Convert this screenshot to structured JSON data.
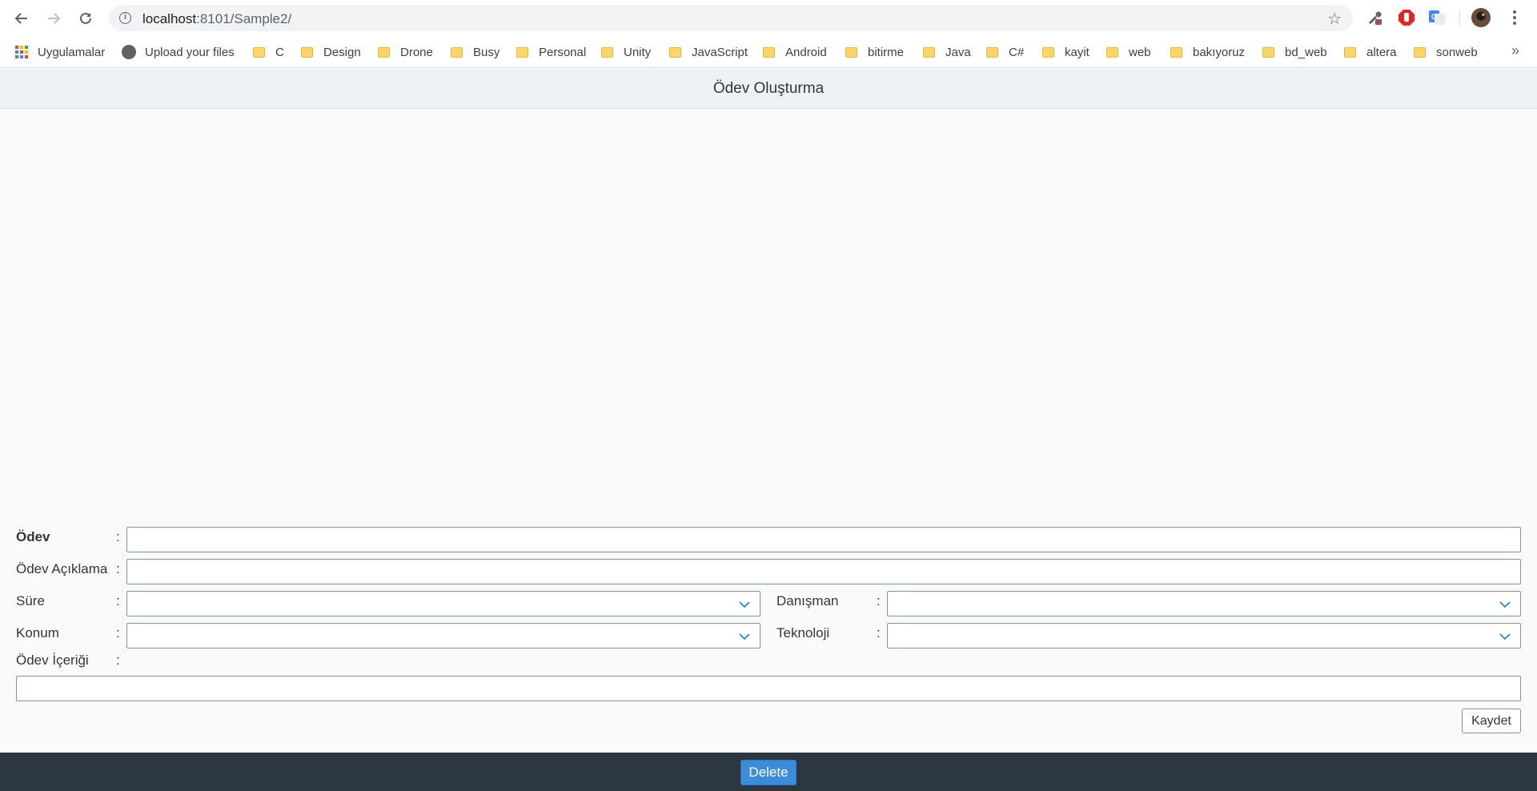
{
  "browser": {
    "url_host": "localhost",
    "url_path": ":8101/Sample2/",
    "bookmarks": {
      "apps": "Uygulamalar",
      "upload": "Upload your files",
      "folders": [
        "C",
        "Design",
        "Drone",
        "Busy",
        "Personal",
        "Unity",
        "JavaScript",
        "Android",
        "bitirme",
        "Java",
        "C#",
        "kayit",
        "web",
        "bakıyoruz",
        "bd_web",
        "altera",
        "sonweb"
      ],
      "more": "»"
    }
  },
  "app": {
    "title": "Ödev Oluşturma"
  },
  "form": {
    "odev_label": "Ödev",
    "aciklama_label": "Ödev Açıklama",
    "sure_label": "Süre",
    "danisman_label": "Danışman",
    "konum_label": "Konum",
    "teknoloji_label": "Teknoloji",
    "icerik_label": "Ödev İçeriği",
    "colon": ":",
    "odev_value": "",
    "aciklama_value": "",
    "icerik_value": "",
    "save_label": "Kaydet"
  },
  "footer": {
    "delete_label": "Delete"
  },
  "colors": {
    "accent": "#3d8cd8",
    "footer_bg": "#2c3742",
    "header_bg": "#eef2f5"
  }
}
